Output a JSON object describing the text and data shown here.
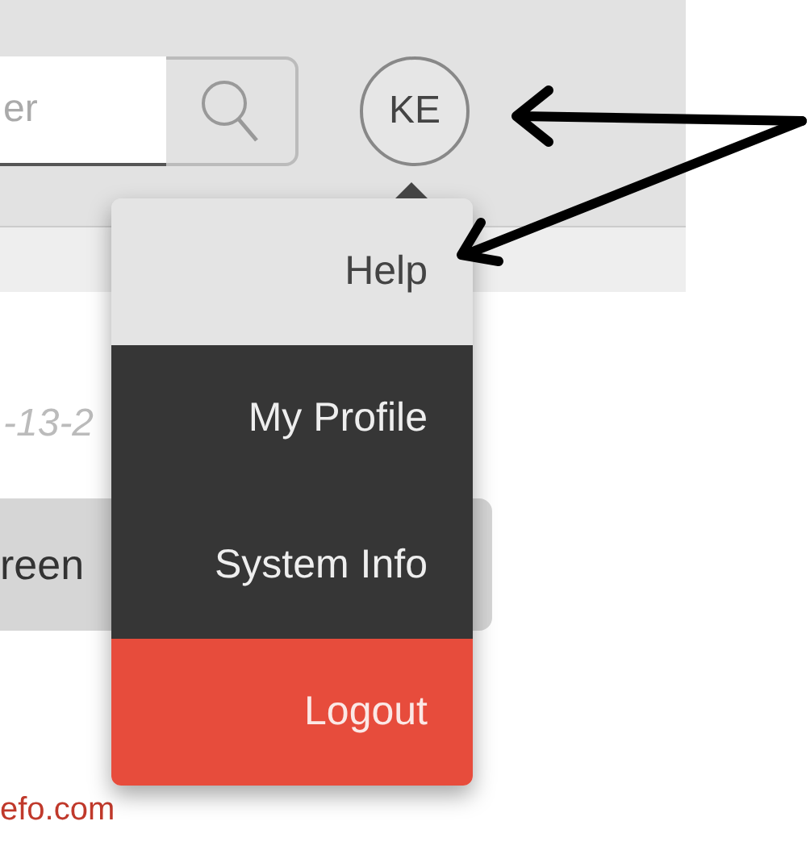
{
  "header": {
    "search": {
      "placeholder": "er"
    },
    "avatar": {
      "initials": "KE"
    }
  },
  "content": {
    "date": "-13-2",
    "bar_text": "reen",
    "link": "efo.com"
  },
  "user_menu": {
    "items": [
      {
        "label": "Help",
        "kind": "hover"
      },
      {
        "label": "My Profile",
        "kind": "normal"
      },
      {
        "label": "System Info",
        "kind": "normal"
      },
      {
        "label": "Logout",
        "kind": "danger"
      }
    ]
  }
}
